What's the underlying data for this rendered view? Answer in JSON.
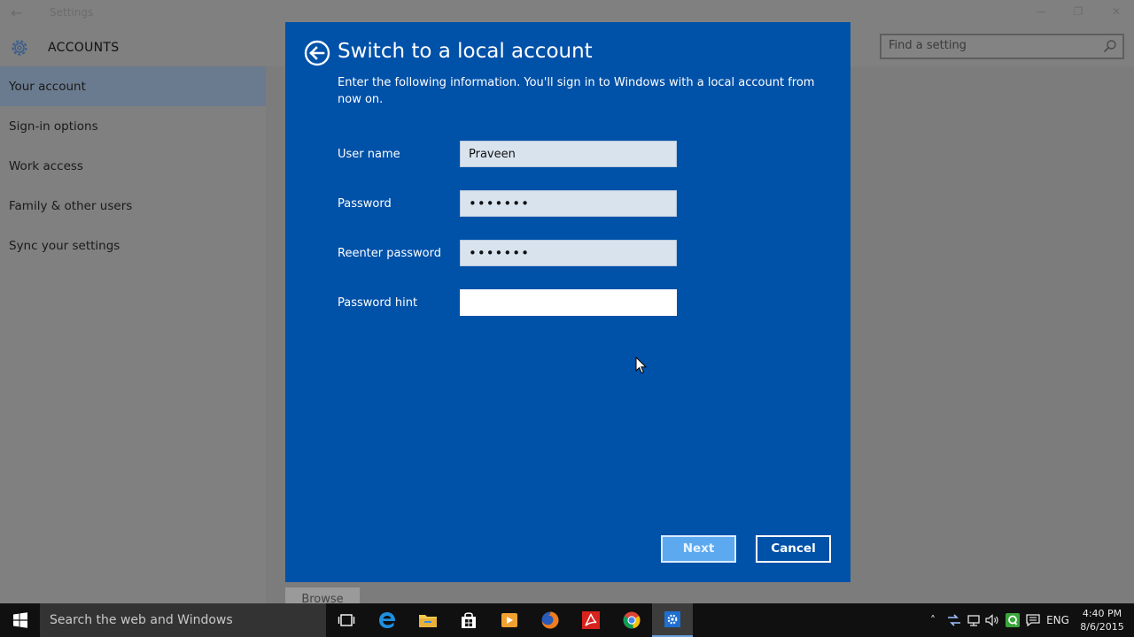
{
  "window": {
    "title": "Settings",
    "minimize": "—",
    "maximize": "❐",
    "close": "✕"
  },
  "sidebar": {
    "header": "ACCOUNTS",
    "items": [
      {
        "label": "Your account"
      },
      {
        "label": "Sign-in options"
      },
      {
        "label": "Work access"
      },
      {
        "label": "Family & other users"
      },
      {
        "label": "Sync your settings"
      }
    ]
  },
  "search": {
    "placeholder": "Find a setting"
  },
  "background": {
    "browse_label": "Browse"
  },
  "dialog": {
    "title": "Switch to a local account",
    "description": "Enter the following information. You'll sign in to Windows with a local account from now on.",
    "fields": {
      "username": {
        "label": "User name",
        "value": "Praveen"
      },
      "password": {
        "label": "Password",
        "value": "•••••••"
      },
      "reenter": {
        "label": "Reenter password",
        "value": "•••••••"
      },
      "hint": {
        "label": "Password hint",
        "value": ""
      }
    },
    "next_label": "Next",
    "cancel_label": "Cancel",
    "accent": "#0051a8"
  },
  "taskbar": {
    "search_text": "Search the web and Windows",
    "apps": [
      "task-view-icon",
      "edge-icon",
      "file-explorer-icon",
      "store-icon",
      "media-player-icon",
      "firefox-icon",
      "acrobat-icon",
      "chrome-icon",
      "settings-icon"
    ],
    "language": "ENG",
    "time": "4:40 PM",
    "date": "8/6/2015"
  }
}
